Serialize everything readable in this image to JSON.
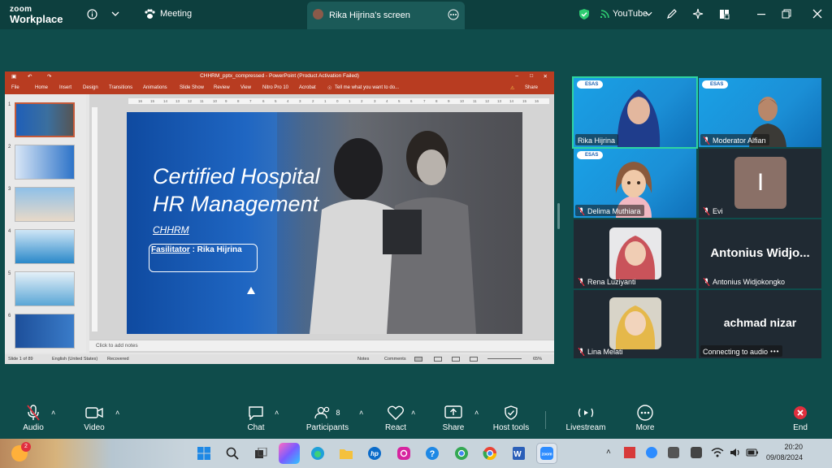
{
  "zoom": {
    "logo_line1": "zoom",
    "logo_line2": "Workplace",
    "meeting_label": "Meeting",
    "screen_tab_label": "Rika Hijrina's screen",
    "youtube_label": "YouTube"
  },
  "ppt": {
    "window_title": "CHHRM_pptx_compressed - PowerPoint (Product Activation Failed)",
    "ribbon_tabs": [
      "File",
      "Home",
      "Insert",
      "Design",
      "Transitions",
      "Animations",
      "Slide Show",
      "Review",
      "View",
      "Nitro Pro 10",
      "Acrobat"
    ],
    "tell_me": "Tell me what you want to do...",
    "share": "Share",
    "ruler_labels": [
      "16",
      "15",
      "14",
      "13",
      "12",
      "11",
      "10",
      "9",
      "8",
      "7",
      "6",
      "5",
      "4",
      "3",
      "2",
      "1",
      "0",
      "1",
      "2",
      "3",
      "4",
      "5",
      "6",
      "7",
      "8",
      "9",
      "10",
      "11",
      "12",
      "13",
      "14",
      "15",
      "16"
    ],
    "thumbnail_numbers": [
      "1",
      "2",
      "3",
      "4",
      "5",
      "6"
    ],
    "slide": {
      "title_line1": "Certified Hospital",
      "title_line2": "HR Management",
      "subtitle": "CHHRM",
      "facilitator_label": "Fasilitator",
      "facilitator_name": " : Rika Hijrina"
    },
    "notes_placeholder": "Click to add notes",
    "status": {
      "slide_counter": "Slide 1 of 89",
      "language": "English (United States)",
      "recovered": "Recovered",
      "notes_btn": "Notes",
      "comments_btn": "Comments",
      "zoom_level": "65%"
    }
  },
  "gallery": {
    "participants": [
      {
        "name": "Rika Hijrina",
        "muted": false,
        "view": "video"
      },
      {
        "name": "Moderator Alfian",
        "muted": true,
        "view": "video"
      },
      {
        "name": "Delima Muthiara",
        "muted": true,
        "view": "video"
      },
      {
        "name": "Evi",
        "muted": true,
        "view": "initial",
        "initial": "I"
      },
      {
        "name": "Rena Luziyanti",
        "muted": true,
        "view": "photo"
      },
      {
        "name": "Antonius Widjokongko",
        "muted": true,
        "view": "name",
        "display_name": "Antonius  Widjo..."
      },
      {
        "name": "Lina Melati",
        "muted": true,
        "view": "photo"
      },
      {
        "name": "Connecting to audio",
        "muted": false,
        "view": "name",
        "display_name": "achmad nizar"
      }
    ],
    "brand_badge": "ESAS"
  },
  "toolbar": {
    "audio": "Audio",
    "video": "Video",
    "chat": "Chat",
    "participants": "Participants",
    "participants_count": "8",
    "react": "React",
    "share": "Share",
    "host_tools": "Host tools",
    "livestream": "Livestream",
    "more": "More",
    "end": "End"
  },
  "taskbar": {
    "time": "20:20",
    "date": "09/08/2024",
    "notification_count": "2"
  },
  "colors": {
    "zoom_bg": "#0f4c4b",
    "ppt_accent": "#b83c21",
    "active_speaker": "#2ed5a0",
    "end_red": "#e02f3e"
  }
}
